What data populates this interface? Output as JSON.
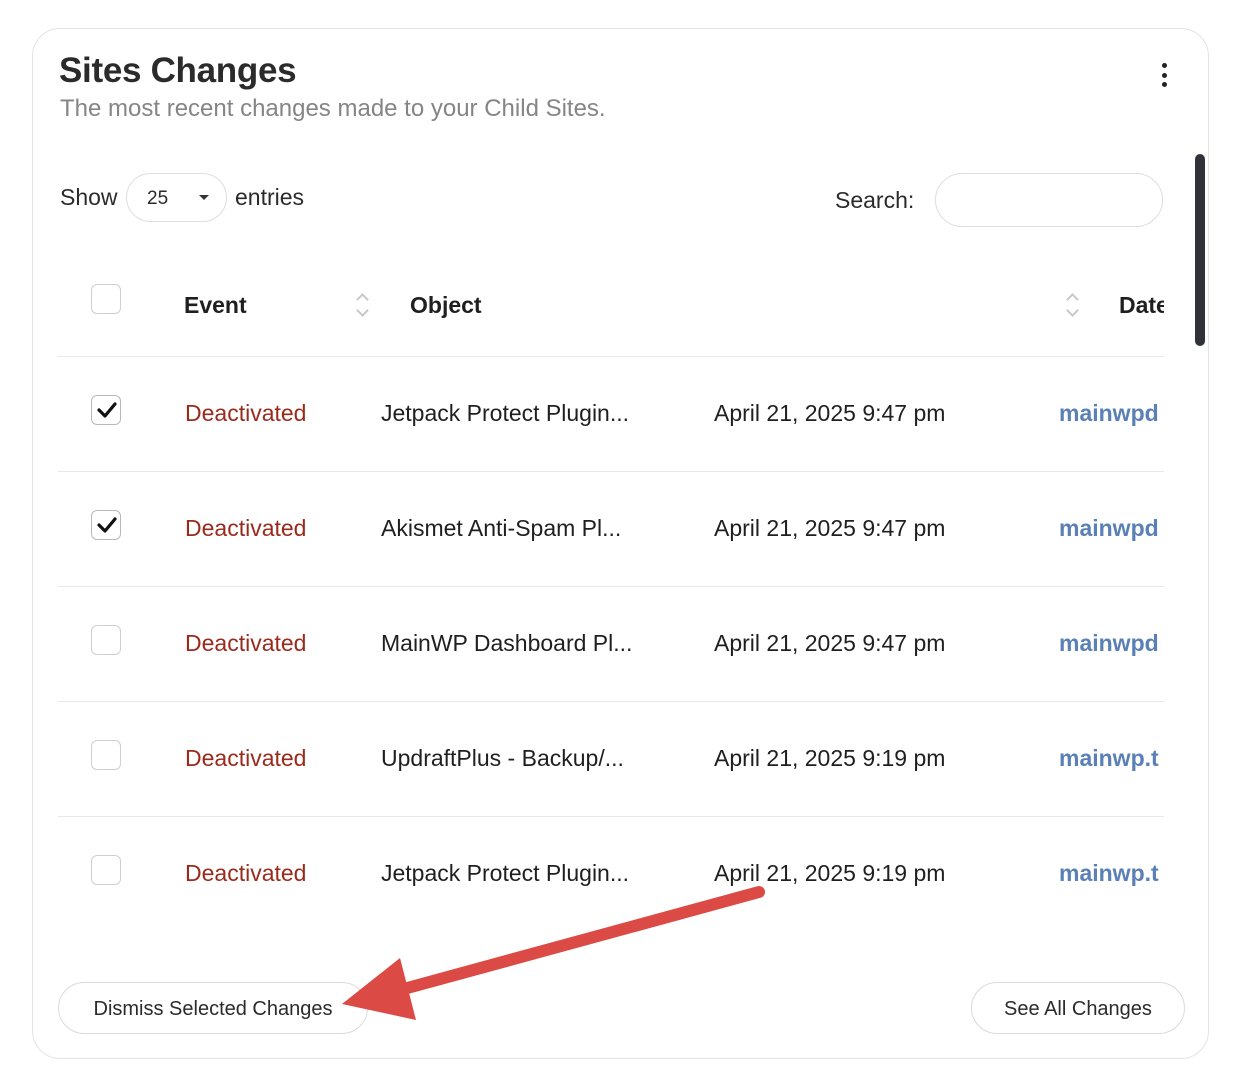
{
  "widget": {
    "title": "Sites Changes",
    "subtitle": "The most recent changes made to your Child Sites.",
    "menu_icon": "kebab-menu-icon"
  },
  "controls": {
    "show_label": "Show",
    "length_value": "25",
    "entries_label": "entries",
    "search_label": "Search:",
    "search_value": ""
  },
  "table": {
    "columns": [
      "Event",
      "Object",
      "Date"
    ],
    "rows": [
      {
        "checked": true,
        "event": "Deactivated",
        "object": "Jetpack Protect Plugin...",
        "date": "April 21, 2025 9:47 pm",
        "site": "mainwpd"
      },
      {
        "checked": true,
        "event": "Deactivated",
        "object": "Akismet Anti-Spam Pl...",
        "date": "April 21, 2025 9:47 pm",
        "site": "mainwpd"
      },
      {
        "checked": false,
        "event": "Deactivated",
        "object": "MainWP Dashboard Pl...",
        "date": "April 21, 2025 9:47 pm",
        "site": "mainwpd"
      },
      {
        "checked": false,
        "event": "Deactivated",
        "object": "UpdraftPlus - Backup/...",
        "date": "April 21, 2025 9:19 pm",
        "site": "mainwp.t"
      },
      {
        "checked": false,
        "event": "Deactivated",
        "object": "Jetpack Protect Plugin...",
        "date": "April 21, 2025 9:19 pm",
        "site": "mainwp.t"
      }
    ]
  },
  "footer": {
    "dismiss_label": "Dismiss Selected Changes",
    "see_all_label": "See All Changes"
  },
  "colors": {
    "event_deactivated": "#9a2a1c",
    "site_link": "#5a80b6",
    "annotation_arrow": "#db4a45"
  }
}
